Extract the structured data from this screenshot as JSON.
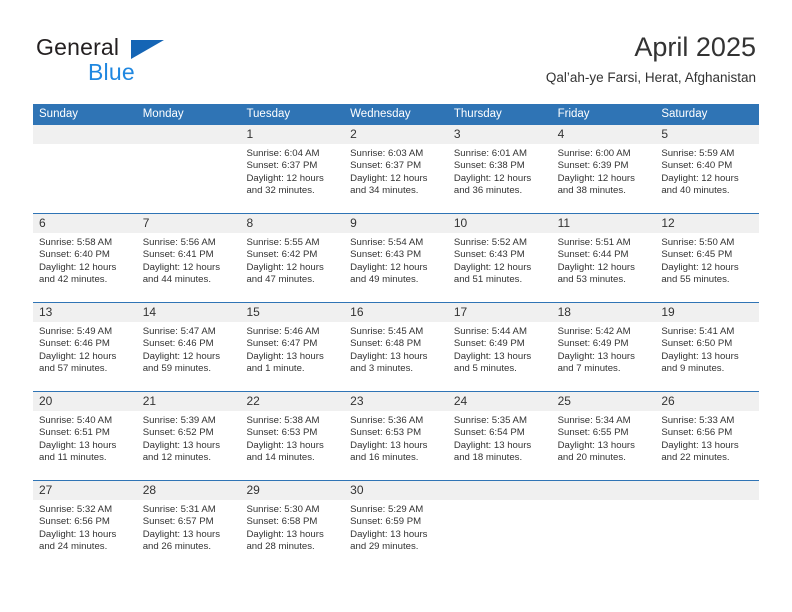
{
  "brand": {
    "name_dark": "General",
    "name_blue": "Blue",
    "triangle_icon": "triangle-icon",
    "accent_dark_blue": "#1565b5",
    "accent_light_blue": "#1f87e0"
  },
  "header": {
    "title": "April 2025",
    "subtitle": "Qal’ah-ye Farsi, Herat, Afghanistan"
  },
  "theme": {
    "header_blue": "#2f74b5",
    "daynum_gray": "#f0f0f0",
    "text": "#333333"
  },
  "calendar": {
    "day_headers": [
      "Sunday",
      "Monday",
      "Tuesday",
      "Wednesday",
      "Thursday",
      "Friday",
      "Saturday"
    ],
    "weeks": [
      [
        {
          "day": "",
          "sunrise": "",
          "sunset": "",
          "daylight1": "",
          "daylight2": ""
        },
        {
          "day": "",
          "sunrise": "",
          "sunset": "",
          "daylight1": "",
          "daylight2": ""
        },
        {
          "day": "1",
          "sunrise": "Sunrise: 6:04 AM",
          "sunset": "Sunset: 6:37 PM",
          "daylight1": "Daylight: 12 hours",
          "daylight2": "and 32 minutes."
        },
        {
          "day": "2",
          "sunrise": "Sunrise: 6:03 AM",
          "sunset": "Sunset: 6:37 PM",
          "daylight1": "Daylight: 12 hours",
          "daylight2": "and 34 minutes."
        },
        {
          "day": "3",
          "sunrise": "Sunrise: 6:01 AM",
          "sunset": "Sunset: 6:38 PM",
          "daylight1": "Daylight: 12 hours",
          "daylight2": "and 36 minutes."
        },
        {
          "day": "4",
          "sunrise": "Sunrise: 6:00 AM",
          "sunset": "Sunset: 6:39 PM",
          "daylight1": "Daylight: 12 hours",
          "daylight2": "and 38 minutes."
        },
        {
          "day": "5",
          "sunrise": "Sunrise: 5:59 AM",
          "sunset": "Sunset: 6:40 PM",
          "daylight1": "Daylight: 12 hours",
          "daylight2": "and 40 minutes."
        }
      ],
      [
        {
          "day": "6",
          "sunrise": "Sunrise: 5:58 AM",
          "sunset": "Sunset: 6:40 PM",
          "daylight1": "Daylight: 12 hours",
          "daylight2": "and 42 minutes."
        },
        {
          "day": "7",
          "sunrise": "Sunrise: 5:56 AM",
          "sunset": "Sunset: 6:41 PM",
          "daylight1": "Daylight: 12 hours",
          "daylight2": "and 44 minutes."
        },
        {
          "day": "8",
          "sunrise": "Sunrise: 5:55 AM",
          "sunset": "Sunset: 6:42 PM",
          "daylight1": "Daylight: 12 hours",
          "daylight2": "and 47 minutes."
        },
        {
          "day": "9",
          "sunrise": "Sunrise: 5:54 AM",
          "sunset": "Sunset: 6:43 PM",
          "daylight1": "Daylight: 12 hours",
          "daylight2": "and 49 minutes."
        },
        {
          "day": "10",
          "sunrise": "Sunrise: 5:52 AM",
          "sunset": "Sunset: 6:43 PM",
          "daylight1": "Daylight: 12 hours",
          "daylight2": "and 51 minutes."
        },
        {
          "day": "11",
          "sunrise": "Sunrise: 5:51 AM",
          "sunset": "Sunset: 6:44 PM",
          "daylight1": "Daylight: 12 hours",
          "daylight2": "and 53 minutes."
        },
        {
          "day": "12",
          "sunrise": "Sunrise: 5:50 AM",
          "sunset": "Sunset: 6:45 PM",
          "daylight1": "Daylight: 12 hours",
          "daylight2": "and 55 minutes."
        }
      ],
      [
        {
          "day": "13",
          "sunrise": "Sunrise: 5:49 AM",
          "sunset": "Sunset: 6:46 PM",
          "daylight1": "Daylight: 12 hours",
          "daylight2": "and 57 minutes."
        },
        {
          "day": "14",
          "sunrise": "Sunrise: 5:47 AM",
          "sunset": "Sunset: 6:46 PM",
          "daylight1": "Daylight: 12 hours",
          "daylight2": "and 59 minutes."
        },
        {
          "day": "15",
          "sunrise": "Sunrise: 5:46 AM",
          "sunset": "Sunset: 6:47 PM",
          "daylight1": "Daylight: 13 hours",
          "daylight2": "and 1 minute."
        },
        {
          "day": "16",
          "sunrise": "Sunrise: 5:45 AM",
          "sunset": "Sunset: 6:48 PM",
          "daylight1": "Daylight: 13 hours",
          "daylight2": "and 3 minutes."
        },
        {
          "day": "17",
          "sunrise": "Sunrise: 5:44 AM",
          "sunset": "Sunset: 6:49 PM",
          "daylight1": "Daylight: 13 hours",
          "daylight2": "and 5 minutes."
        },
        {
          "day": "18",
          "sunrise": "Sunrise: 5:42 AM",
          "sunset": "Sunset: 6:49 PM",
          "daylight1": "Daylight: 13 hours",
          "daylight2": "and 7 minutes."
        },
        {
          "day": "19",
          "sunrise": "Sunrise: 5:41 AM",
          "sunset": "Sunset: 6:50 PM",
          "daylight1": "Daylight: 13 hours",
          "daylight2": "and 9 minutes."
        }
      ],
      [
        {
          "day": "20",
          "sunrise": "Sunrise: 5:40 AM",
          "sunset": "Sunset: 6:51 PM",
          "daylight1": "Daylight: 13 hours",
          "daylight2": "and 11 minutes."
        },
        {
          "day": "21",
          "sunrise": "Sunrise: 5:39 AM",
          "sunset": "Sunset: 6:52 PM",
          "daylight1": "Daylight: 13 hours",
          "daylight2": "and 12 minutes."
        },
        {
          "day": "22",
          "sunrise": "Sunrise: 5:38 AM",
          "sunset": "Sunset: 6:53 PM",
          "daylight1": "Daylight: 13 hours",
          "daylight2": "and 14 minutes."
        },
        {
          "day": "23",
          "sunrise": "Sunrise: 5:36 AM",
          "sunset": "Sunset: 6:53 PM",
          "daylight1": "Daylight: 13 hours",
          "daylight2": "and 16 minutes."
        },
        {
          "day": "24",
          "sunrise": "Sunrise: 5:35 AM",
          "sunset": "Sunset: 6:54 PM",
          "daylight1": "Daylight: 13 hours",
          "daylight2": "and 18 minutes."
        },
        {
          "day": "25",
          "sunrise": "Sunrise: 5:34 AM",
          "sunset": "Sunset: 6:55 PM",
          "daylight1": "Daylight: 13 hours",
          "daylight2": "and 20 minutes."
        },
        {
          "day": "26",
          "sunrise": "Sunrise: 5:33 AM",
          "sunset": "Sunset: 6:56 PM",
          "daylight1": "Daylight: 13 hours",
          "daylight2": "and 22 minutes."
        }
      ],
      [
        {
          "day": "27",
          "sunrise": "Sunrise: 5:32 AM",
          "sunset": "Sunset: 6:56 PM",
          "daylight1": "Daylight: 13 hours",
          "daylight2": "and 24 minutes."
        },
        {
          "day": "28",
          "sunrise": "Sunrise: 5:31 AM",
          "sunset": "Sunset: 6:57 PM",
          "daylight1": "Daylight: 13 hours",
          "daylight2": "and 26 minutes."
        },
        {
          "day": "29",
          "sunrise": "Sunrise: 5:30 AM",
          "sunset": "Sunset: 6:58 PM",
          "daylight1": "Daylight: 13 hours",
          "daylight2": "and 28 minutes."
        },
        {
          "day": "30",
          "sunrise": "Sunrise: 5:29 AM",
          "sunset": "Sunset: 6:59 PM",
          "daylight1": "Daylight: 13 hours",
          "daylight2": "and 29 minutes."
        },
        {
          "day": "",
          "sunrise": "",
          "sunset": "",
          "daylight1": "",
          "daylight2": ""
        },
        {
          "day": "",
          "sunrise": "",
          "sunset": "",
          "daylight1": "",
          "daylight2": ""
        },
        {
          "day": "",
          "sunrise": "",
          "sunset": "",
          "daylight1": "",
          "daylight2": ""
        }
      ]
    ]
  }
}
